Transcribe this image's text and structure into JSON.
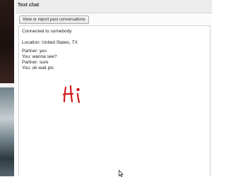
{
  "chat": {
    "title": "Text chat",
    "history_button_label": "View or report past conversations",
    "system_message": "Connected to somebody",
    "location_line": "Location: United States, TX",
    "messages": [
      {
        "text": "Partner: yes"
      },
      {
        "text": "You: wanna see?"
      },
      {
        "text": "Partner: sure"
      },
      {
        "text": "You: ok wait pls"
      }
    ]
  },
  "annotation": {
    "text": "Hi",
    "color": "#d11a1a"
  },
  "icons": {
    "cursor": "mouse-cursor-icon"
  }
}
